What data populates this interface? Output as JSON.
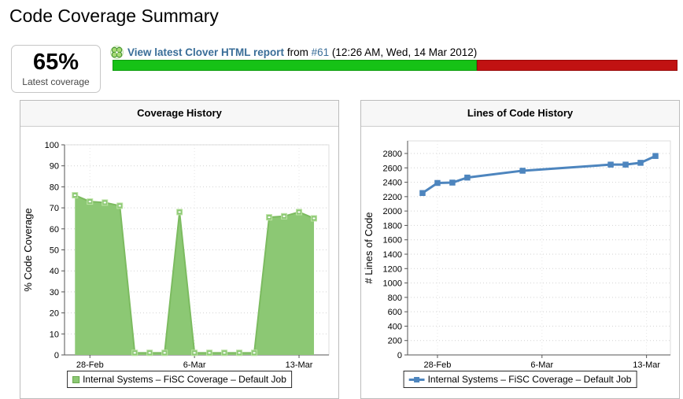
{
  "page_title": "Code Coverage Summary",
  "summary": {
    "coverage_value": "65%",
    "coverage_caption": "Latest coverage",
    "report_link_label": "View latest Clover HTML report",
    "from_word": "from",
    "build_link_label": "#61",
    "build_timestamp": "(12:26 AM, Wed, 14 Mar 2012)",
    "coverage_bar": {
      "percent_filled": 64.5,
      "fill_color": "#16c216",
      "remainder_color": "#c11212"
    }
  },
  "chart_data": [
    {
      "type": "area",
      "title": "Coverage History",
      "ylabel": "% Code Coverage",
      "ylim": [
        0,
        100
      ],
      "y_tick_step": 10,
      "x_domain": [
        -0.7,
        17.0
      ],
      "x_ticks": [
        {
          "day": 1,
          "label": "28-Feb"
        },
        {
          "day": 8,
          "label": "6-Mar"
        },
        {
          "day": 15,
          "label": "13-Mar"
        }
      ],
      "grid": true,
      "legend_position": "bottom",
      "legend_label": "Internal Systems – FiSC Coverage – Default Job",
      "series": [
        {
          "name": "Internal Systems – FiSC Coverage – Default Job",
          "color": "#8cc874",
          "line_color": "#7cbb60",
          "x_days": [
            0,
            1,
            2,
            3,
            4,
            5,
            6,
            7,
            8,
            9,
            10,
            11,
            12,
            13,
            14,
            15,
            16
          ],
          "values": [
            76,
            73,
            72.5,
            71,
            1,
            1,
            1,
            68,
            1,
            1,
            1,
            1,
            1,
            65.5,
            66,
            68,
            65
          ]
        }
      ]
    },
    {
      "type": "line",
      "title": "Lines of Code History",
      "ylabel": "# Lines of Code",
      "ylim": [
        0,
        2800
      ],
      "y_tick_step": 200,
      "x_domain": [
        -1.0,
        16.6
      ],
      "x_ticks": [
        {
          "day": 1,
          "label": "28-Feb"
        },
        {
          "day": 8,
          "label": "6-Mar"
        },
        {
          "day": 15,
          "label": "13-Mar"
        }
      ],
      "grid": true,
      "legend_position": "bottom",
      "legend_label": "Internal Systems – FiSC Coverage – Default Job",
      "series": [
        {
          "name": "Internal Systems – FiSC Coverage – Default Job",
          "color": "#4d85be",
          "x_days": [
            0,
            1,
            2,
            3,
            6.7,
            12.6,
            13.6,
            14.6,
            15.6
          ],
          "values": [
            2250,
            2390,
            2395,
            2465,
            2560,
            2645,
            2645,
            2670,
            2765
          ]
        }
      ]
    }
  ]
}
